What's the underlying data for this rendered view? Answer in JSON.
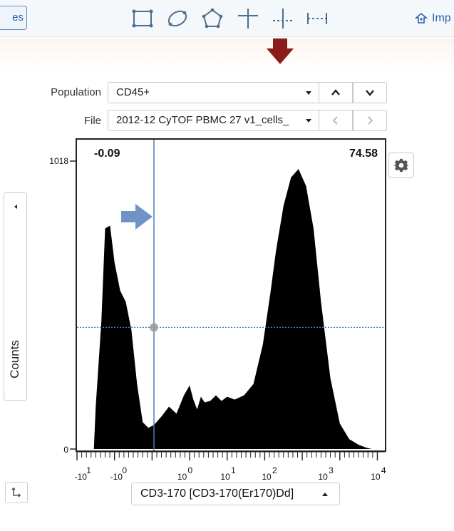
{
  "toolbar": {
    "left_button_label": "es",
    "tools": [
      {
        "name": "rectangle-gate-tool",
        "icon": "rectangle-icon"
      },
      {
        "name": "ellipse-gate-tool",
        "icon": "ellipse-icon"
      },
      {
        "name": "polygon-gate-tool",
        "icon": "polygon-icon"
      },
      {
        "name": "quadrant-gate-tool",
        "icon": "quadrant-icon"
      },
      {
        "name": "split-gate-tool",
        "icon": "split-icon"
      },
      {
        "name": "range-gate-tool",
        "icon": "range-icon"
      }
    ],
    "import_label": "Imp",
    "import_icon": "import-icon",
    "accent": "#2a63a8",
    "highlight_arrow_color": "#8b1a1a"
  },
  "form": {
    "population_label": "Population",
    "population_value": "CD45+",
    "file_label": "File",
    "file_value": "2012-12 CyTOF PBMC 27 v1_cells_"
  },
  "plot": {
    "left_stat": "-0.09",
    "right_stat": "74.58",
    "y_axis_title": "Counts",
    "x_axis_button_label": "CD3-170 [CD3-170(Er170)Dd]",
    "gear_icon": "gear-icon",
    "gate_line_color": "#4a7fb0",
    "arrow_color": "#6f94c4"
  },
  "chart_data": {
    "type": "area",
    "x_scale": "arcsinh",
    "x": [
      -0.55,
      -0.5,
      -0.35,
      -0.25,
      -0.12,
      0.0,
      0.15,
      0.3,
      0.45,
      0.6,
      0.75,
      0.9,
      1.05,
      1.25,
      1.45,
      1.65,
      1.85,
      2.0,
      2.1,
      2.2,
      2.3,
      2.4,
      2.55,
      2.7,
      2.85,
      3.0,
      3.2,
      3.45,
      3.7,
      3.95,
      4.15,
      4.3,
      4.5,
      4.7,
      4.9,
      5.1,
      5.3,
      5.5,
      5.75,
      6.0,
      6.25,
      6.5,
      6.7,
      6.85
    ],
    "y": [
      0,
      150,
      450,
      780,
      790,
      660,
      560,
      520,
      420,
      230,
      95,
      75,
      85,
      115,
      150,
      125,
      190,
      225,
      175,
      140,
      185,
      165,
      170,
      190,
      170,
      185,
      175,
      190,
      230,
      370,
      550,
      700,
      860,
      960,
      990,
      930,
      780,
      520,
      250,
      90,
      35,
      15,
      5,
      0
    ],
    "ylim": [
      0,
      1018
    ],
    "yticks": [
      "0",
      "1018"
    ],
    "xtick_labels": [
      {
        "base": "-10",
        "exp": "1"
      },
      {
        "base": "-10",
        "exp": "0"
      },
      {
        "base": "10",
        "exp": "0"
      },
      {
        "base": "10",
        "exp": "1"
      },
      {
        "base": "10",
        "exp": "2"
      },
      {
        "base": "10",
        "exp": "3"
      },
      {
        "base": "10",
        "exp": "4"
      }
    ],
    "gate_x": 1.05,
    "gate_y": 430,
    "xlim": [
      -1.0,
      7.2
    ]
  }
}
